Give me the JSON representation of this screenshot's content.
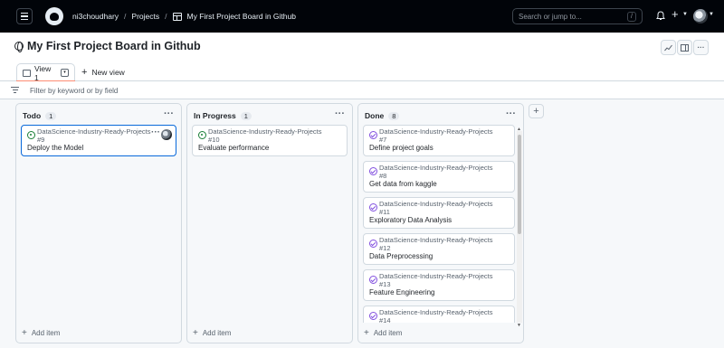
{
  "header": {
    "breadcrumbs": [
      "ni3choudhary",
      "Projects",
      "My First Project Board in Github"
    ],
    "search_placeholder": "Search or jump to...",
    "search_shortcut": "/"
  },
  "project": {
    "title": "My First Project Board in Github"
  },
  "tabs": {
    "active_label": "View 1",
    "new_view_label": "New view"
  },
  "filter": {
    "placeholder": "Filter by keyword or by field"
  },
  "columns": [
    {
      "name": "Todo",
      "count": "1",
      "add_label": "Add item",
      "cards": [
        {
          "repo": "DataScience-Industry-Ready-Projects",
          "number": "#9",
          "title": "Deploy the Model",
          "status": "open"
        }
      ]
    },
    {
      "name": "In Progress",
      "count": "1",
      "add_label": "Add item",
      "cards": [
        {
          "repo": "DataScience-Industry-Ready-Projects",
          "number": "#10",
          "title": "Evaluate performance",
          "status": "open"
        }
      ]
    },
    {
      "name": "Done",
      "count": "8",
      "add_label": "Add item",
      "cards": [
        {
          "repo": "DataScience-Industry-Ready-Projects",
          "number": "#7",
          "title": "Define project goals",
          "status": "closed"
        },
        {
          "repo": "DataScience-Industry-Ready-Projects",
          "number": "#8",
          "title": "Get data from kaggle",
          "status": "closed"
        },
        {
          "repo": "DataScience-Industry-Ready-Projects",
          "number": "#11",
          "title": "Exploratory Data Analysis",
          "status": "closed"
        },
        {
          "repo": "DataScience-Industry-Ready-Projects",
          "number": "#12",
          "title": "Data Preprocessing",
          "status": "closed"
        },
        {
          "repo": "DataScience-Industry-Ready-Projects",
          "number": "#13",
          "title": "Feature Engineering",
          "status": "closed"
        },
        {
          "repo": "DataScience-Industry-Ready-Projects",
          "number": "#14",
          "title": "",
          "status": "closed"
        }
      ]
    }
  ],
  "colors": {
    "header_bg": "#010409",
    "accent_blue": "#0969da",
    "open_green": "#1a7f37",
    "closed_purple": "#8250df",
    "tab_underline": "#fd8c73"
  },
  "icons": [
    "hamburger-icon",
    "github-logo-icon",
    "project-table-icon",
    "bell-icon",
    "plus-icon",
    "globe-icon",
    "insights-icon",
    "side-panel-icon",
    "kebab-icon",
    "filter-icon",
    "issue-open-icon",
    "issue-closed-icon"
  ]
}
